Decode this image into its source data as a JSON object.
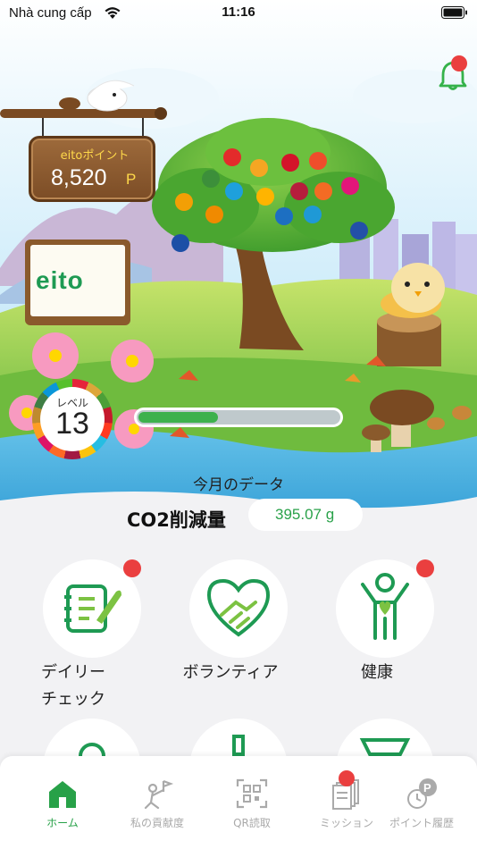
{
  "status_bar": {
    "carrier": "Nhà cung cấp",
    "time": "11:16"
  },
  "points": {
    "title": "eitoポイント",
    "value": "8,520",
    "unit": "P"
  },
  "brand": {
    "logo_text": "eito"
  },
  "level": {
    "label": "レベル",
    "value": "13",
    "progress": 0.4
  },
  "monthly": {
    "title": "今月のデータ",
    "co2_label": "CO2削減量",
    "co2_value": "395.07 g"
  },
  "menu": [
    {
      "label": "デイリー\nチェック",
      "icon": "daily-check-icon",
      "badge": true
    },
    {
      "label": "ボランティア",
      "icon": "handshake-icon",
      "badge": false
    },
    {
      "label": "健康",
      "icon": "health-person-icon",
      "badge": true
    }
  ],
  "tabs": [
    {
      "label": "ホーム",
      "icon": "home-icon",
      "active": true
    },
    {
      "label": "私の貢献度",
      "icon": "contribution-flag-icon",
      "active": false
    },
    {
      "label": "QR読取",
      "icon": "qr-scan-icon",
      "active": false
    },
    {
      "label": "ミッション",
      "icon": "mission-cards-icon",
      "active": false,
      "badge": true
    },
    {
      "label": "ポイント履歴",
      "icon": "point-history-icon",
      "active": false
    }
  ],
  "colors": {
    "accent_green": "#27a148",
    "badge_red": "#ea3f3f",
    "sky": "#bde6f7",
    "grass": "#7fc437",
    "water": "#3fa8d8"
  }
}
